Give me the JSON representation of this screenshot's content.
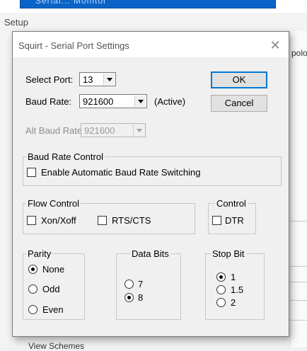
{
  "background": {
    "setup_title": "Setup",
    "right_clip_text": "polo",
    "bottom_clip_text": "View Schemes",
    "selected_row_text": "Serial... Monitor"
  },
  "dialog": {
    "title": "Squirt - Serial Port Settings",
    "close_glyph": "✕",
    "select_port": {
      "label": "Select Port:",
      "value": "13"
    },
    "baud_rate": {
      "label": "Baud Rate:",
      "value": "921600",
      "status": "(Active)"
    },
    "alt_baud_rate": {
      "label": "Alt Baud Rate:",
      "value": "921600",
      "enabled": false
    },
    "ok_label": "OK",
    "cancel_label": "Cancel",
    "baud_rate_control": {
      "caption": "Baud Rate Control",
      "enable_auto_label": "Enable Automatic Baud Rate Switching",
      "enable_auto_checked": false
    },
    "flow_control": {
      "caption": "Flow Control",
      "xon_xoff_label": "Xon/Xoff",
      "xon_xoff_checked": false,
      "rts_cts_label": "RTS/CTS",
      "rts_cts_checked": false
    },
    "control": {
      "caption": "Control",
      "dtr_label": "DTR",
      "dtr_checked": false
    },
    "parity": {
      "caption": "Parity",
      "options": [
        "None",
        "Odd",
        "Even"
      ],
      "selected": "None"
    },
    "data_bits": {
      "caption": "Data Bits",
      "options": [
        "7",
        "8"
      ],
      "selected": "8"
    },
    "stop_bit": {
      "caption": "Stop Bit",
      "options": [
        "1",
        "1.5",
        "2"
      ],
      "selected": "1"
    }
  },
  "colors": {
    "default_button_border": "#0078d7",
    "selection_blue": "#0a64c8",
    "dialog_bg": "#f0f0f0"
  }
}
